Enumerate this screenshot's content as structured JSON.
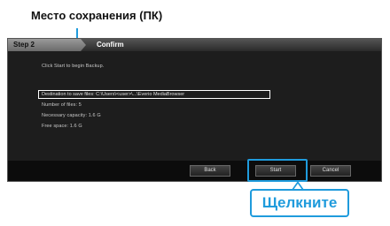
{
  "caption_top": "Место сохранения (ПК)",
  "dialog": {
    "step_label": "Step 2",
    "step_title": "Confirm",
    "lines": [
      "Click Start to begin Backup.",
      "Destination to save files: C:\\Users\\<user>\\...\\Everio MediaBrowser",
      "Number of files: 5",
      "Necessary capacity: 1.6 G",
      "Free space: 1.6 G"
    ],
    "buttons": {
      "back": "Back",
      "start": "Start",
      "cancel": "Cancel"
    }
  },
  "click_label": "Щелкните",
  "colors": {
    "accent": "#1f9bdc",
    "dialog_bg": "#1d1d1d"
  }
}
